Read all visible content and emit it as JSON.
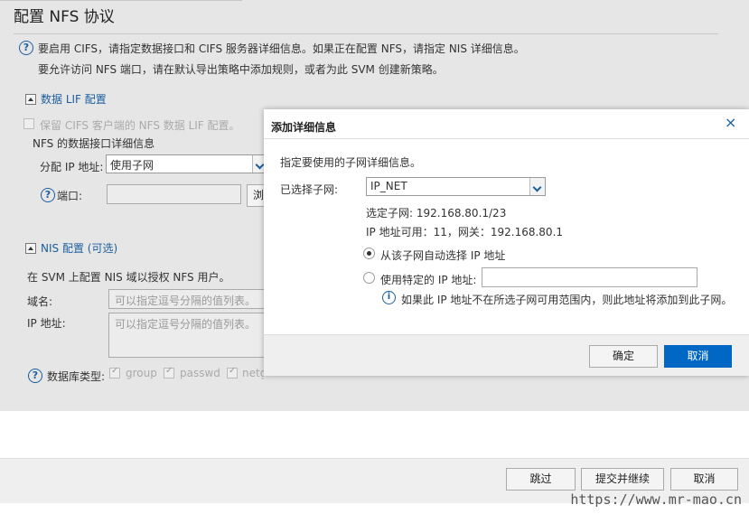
{
  "page": {
    "title": "配置 NFS 协议",
    "help_line1": "要启用 CIFS，请指定数据接口和 CIFS 服务器详细信息。如果正在配置 NFS，请指定 NIS 详细信息。",
    "help_line2": "要允许访问 NFS 端口，请在默认导出策略中添加规则，或者为此 SVM 创建新策略。"
  },
  "lif_section": {
    "title": "数据 LIF 配置",
    "retain_cifs_label": "保留 CIFS 客户端的 NFS 数据 LIF 配置。",
    "nfs_details_label": "NFS 的数据接口详细信息",
    "assign_ip_label": "分配 IP 地址:",
    "assign_ip_value": "使用子网",
    "port_label": "端口:",
    "browse_label": "浏"
  },
  "nis_section": {
    "title": "NIS 配置 (可选)",
    "description": "在 SVM 上配置 NIS 域以授权 NFS 用户。",
    "domain_label": "域名:",
    "domain_placeholder": "可以指定逗号分隔的值列表。",
    "ip_label": "IP 地址:",
    "ip_placeholder": "可以指定逗号分隔的值列表。",
    "db_type_label": "数据库类型:",
    "db_types": [
      "group",
      "passwd",
      "netg"
    ]
  },
  "modal": {
    "title": "添加详细信息",
    "close_symbol": "×",
    "instruction": "指定要使用的子网详细信息。",
    "subnet_label": "已选择子网:",
    "subnet_value": "IP_NET",
    "selected_subnet": "选定子网: 192.168.80.1/23",
    "ip_available": "IP 地址可用：11，网关：192.168.80.1",
    "radio_auto": "从该子网自动选择 IP 地址",
    "radio_specific": "使用特定的 IP 地址:",
    "specific_ip_value": "",
    "info_note": "如果此 IP 地址不在所选子网可用范围内，则此地址将添加到此子网。",
    "ok_label": "确定",
    "cancel_label": "取消"
  },
  "footer": {
    "skip_label": "跳过",
    "submit_label": "提交并继续",
    "cancel_label": "取消"
  },
  "watermark": "https://www.mr-mao.cn",
  "colors": {
    "accent": "#0067c5",
    "link": "#1b5e9e"
  }
}
